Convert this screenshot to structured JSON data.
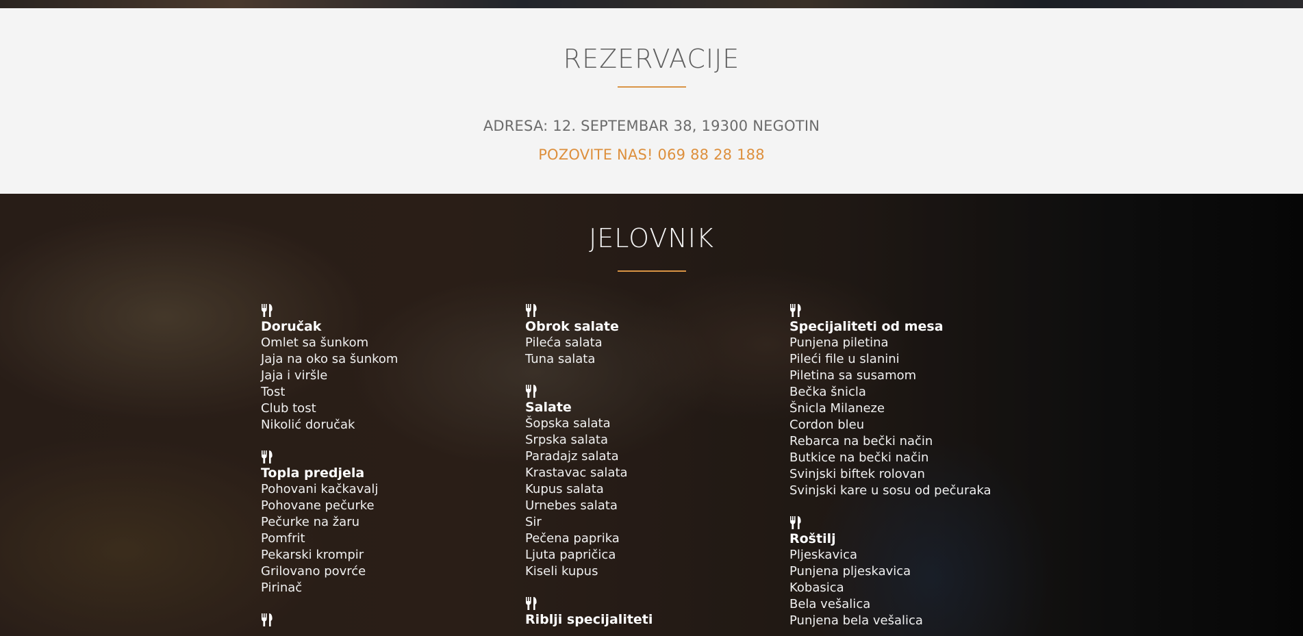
{
  "reservations": {
    "title": "REZERVACIJE",
    "address": "ADRESA: 12. SEPTEMBAR 38, 19300 NEGOTIN",
    "phone": "POZOVITE NAS! 069 88 28 188"
  },
  "menu": {
    "title": "JELOVNIK",
    "icon": "utensils-icon",
    "accent_color": "#d99445",
    "columns": [
      {
        "categories": [
          {
            "title": "Doručak",
            "items": [
              "Omlet sa šunkom",
              "Jaja na oko sa šunkom",
              "Jaja i viršle",
              "Tost",
              "Club tost",
              "Nikolić doručak"
            ]
          },
          {
            "title": "Topla predjela",
            "items": [
              "Pohovani kačkavalj",
              "Pohovane pečurke",
              "Pečurke na žaru",
              "Pomfrit",
              "Pekarski krompir",
              "Grilovano povrće",
              "Pirinač"
            ]
          },
          {
            "title": "",
            "items": []
          }
        ]
      },
      {
        "categories": [
          {
            "title": "Obrok salate",
            "items": [
              "Pileća salata",
              "Tuna salata"
            ]
          },
          {
            "title": "Salate",
            "items": [
              "Šopska salata",
              "Srpska salata",
              "Paradajz salata",
              "Krastavac salata",
              "Kupus salata",
              "Urnebes salata",
              "Sir",
              "Pečena paprika",
              "Ljuta papričica",
              "Kiseli kupus"
            ]
          },
          {
            "title": "Riblji specijaliteti",
            "items": []
          }
        ]
      },
      {
        "categories": [
          {
            "title": "Specijaliteti od mesa",
            "items": [
              "Punjena piletina",
              "Pileći file u slanini",
              "Piletina sa susamom",
              "Bečka šnicla",
              "Šnicla Milaneze",
              "Cordon bleu",
              "Rebarca na bečki način",
              "Butkice na bečki način",
              "Svinjski biftek rolovan",
              "Svinjski kare u sosu od pečuraka"
            ]
          },
          {
            "title": "Roštilj",
            "items": [
              "Pljeskavica",
              "Punjena pljeskavica",
              "Kobasica",
              "Bela vešalica",
              "Punjena bela vešalica"
            ]
          }
        ]
      }
    ]
  }
}
